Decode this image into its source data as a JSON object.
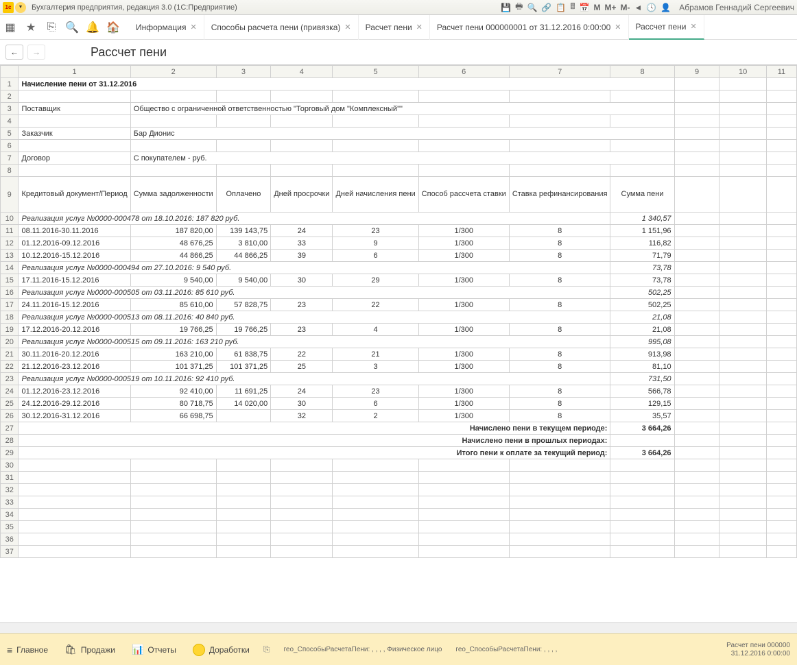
{
  "titlebar": {
    "app_title": "Бухгалтерия предприятия, редакция 3.0  (1С:Предприятие)",
    "user_name": "Абрамов Геннадий Сергеевич",
    "m_buttons": [
      "M",
      "M+",
      "M-"
    ]
  },
  "toolbar": {
    "tabs": [
      {
        "label": "Информация",
        "closable": true
      },
      {
        "label": "Способы расчета пени (привязка)",
        "closable": true
      },
      {
        "label": "Расчет пени",
        "closable": true
      },
      {
        "label": "Расчет пени 000000001 от 31.12.2016 0:00:00",
        "closable": true
      },
      {
        "label": "Рассчет пени",
        "closable": true,
        "active": true
      }
    ]
  },
  "nav": {
    "page_title": "Рассчет пени"
  },
  "sheet": {
    "col_headers": [
      "1",
      "2",
      "3",
      "4",
      "5",
      "6",
      "7",
      "8",
      "9",
      "10",
      "11"
    ],
    "title": "Начисление пени от 31.12.2016",
    "rows_meta": {
      "supplier_label": "Поставщик",
      "supplier_value": "Общество с ограниченной ответственностью \"Торговый дом \"Комплексный\"\"",
      "customer_label": "Заказчик",
      "customer_value": "Бар Дионис",
      "contract_label": "Договор",
      "contract_value": "С покупателем - руб."
    },
    "table_headers": [
      "Кредитовый документ/Период",
      "Сумма задолженности",
      "Оплачено",
      "Дней просрочки",
      "Дней начисления пени",
      "Способ рассчета ставки",
      "Ставка рефинансирования",
      "Сумма пени"
    ],
    "groups": [
      {
        "title": "Реализация услуг №0000-000478 от 18.10.2016: 187 820 руб.",
        "total": "1 340,57",
        "rows": [
          {
            "period": "08.11.2016-30.11.2016",
            "debt": "187 820,00",
            "paid": "139 143,75",
            "days_over": "24",
            "days_calc": "23",
            "method": "1/300",
            "rate": "8",
            "sum": "1 151,96"
          },
          {
            "period": "01.12.2016-09.12.2016",
            "debt": "48 676,25",
            "paid": "3 810,00",
            "days_over": "33",
            "days_calc": "9",
            "method": "1/300",
            "rate": "8",
            "sum": "116,82"
          },
          {
            "period": "10.12.2016-15.12.2016",
            "debt": "44 866,25",
            "paid": "44 866,25",
            "days_over": "39",
            "days_calc": "6",
            "method": "1/300",
            "rate": "8",
            "sum": "71,79"
          }
        ]
      },
      {
        "title": "Реализация услуг №0000-000494 от 27.10.2016: 9 540 руб.",
        "total": "73,78",
        "rows": [
          {
            "period": "17.11.2016-15.12.2016",
            "debt": "9 540,00",
            "paid": "9 540,00",
            "days_over": "30",
            "days_calc": "29",
            "method": "1/300",
            "rate": "8",
            "sum": "73,78"
          }
        ]
      },
      {
        "title": "Реализация услуг №0000-000505 от 03.11.2016: 85 610 руб.",
        "total": "502,25",
        "rows": [
          {
            "period": "24.11.2016-15.12.2016",
            "debt": "85 610,00",
            "paid": "57 828,75",
            "days_over": "23",
            "days_calc": "22",
            "method": "1/300",
            "rate": "8",
            "sum": "502,25"
          }
        ]
      },
      {
        "title": "Реализация услуг №0000-000513 от 08.11.2016: 40 840 руб.",
        "total": "21,08",
        "rows": [
          {
            "period": "17.12.2016-20.12.2016",
            "debt": "19 766,25",
            "paid": "19 766,25",
            "days_over": "23",
            "days_calc": "4",
            "method": "1/300",
            "rate": "8",
            "sum": "21,08"
          }
        ]
      },
      {
        "title": "Реализация услуг №0000-000515 от 09.11.2016: 163 210 руб.",
        "total": "995,08",
        "rows": [
          {
            "period": "30.11.2016-20.12.2016",
            "debt": "163 210,00",
            "paid": "61 838,75",
            "days_over": "22",
            "days_calc": "21",
            "method": "1/300",
            "rate": "8",
            "sum": "913,98"
          },
          {
            "period": "21.12.2016-23.12.2016",
            "debt": "101 371,25",
            "paid": "101 371,25",
            "days_over": "25",
            "days_calc": "3",
            "method": "1/300",
            "rate": "8",
            "sum": "81,10"
          }
        ]
      },
      {
        "title": "Реализация услуг №0000-000519 от 10.11.2016: 92 410 руб.",
        "total": "731,50",
        "rows": [
          {
            "period": "01.12.2016-23.12.2016",
            "debt": "92 410,00",
            "paid": "11 691,25",
            "days_over": "24",
            "days_calc": "23",
            "method": "1/300",
            "rate": "8",
            "sum": "566,78"
          },
          {
            "period": "24.12.2016-29.12.2016",
            "debt": "80 718,75",
            "paid": "14 020,00",
            "days_over": "30",
            "days_calc": "6",
            "method": "1/300",
            "rate": "8",
            "sum": "129,15"
          },
          {
            "period": "30.12.2016-31.12.2016",
            "debt": "66 698,75",
            "paid": "",
            "days_over": "32",
            "days_calc": "2",
            "method": "1/300",
            "rate": "8",
            "sum": "35,57"
          }
        ]
      }
    ],
    "summary": {
      "current_label": "Начислено пени в текущем периоде:",
      "current_value": "3 664,26",
      "past_label": "Начислено пени в прошлых периодах:",
      "past_value": "",
      "total_label": "Итого пени к оплате за текущий период:",
      "total_value": "3 664,26"
    }
  },
  "bottombar": {
    "items": [
      {
        "icon": "≡",
        "label": "Главное"
      },
      {
        "icon": "🛍",
        "label": "Продажи"
      },
      {
        "icon": "📊",
        "label": "Отчеты"
      },
      {
        "icon": "●",
        "label": "Доработки"
      }
    ],
    "crumb1": "гео_СпособыРасчетаПени: , , , , Физическое лицо",
    "crumb2": "гео_СпособыРасчетаПени: , , , ,",
    "crumb3_top": "Расчет пени 000000",
    "crumb3_bottom": "31.12.2016 0:00:00"
  }
}
